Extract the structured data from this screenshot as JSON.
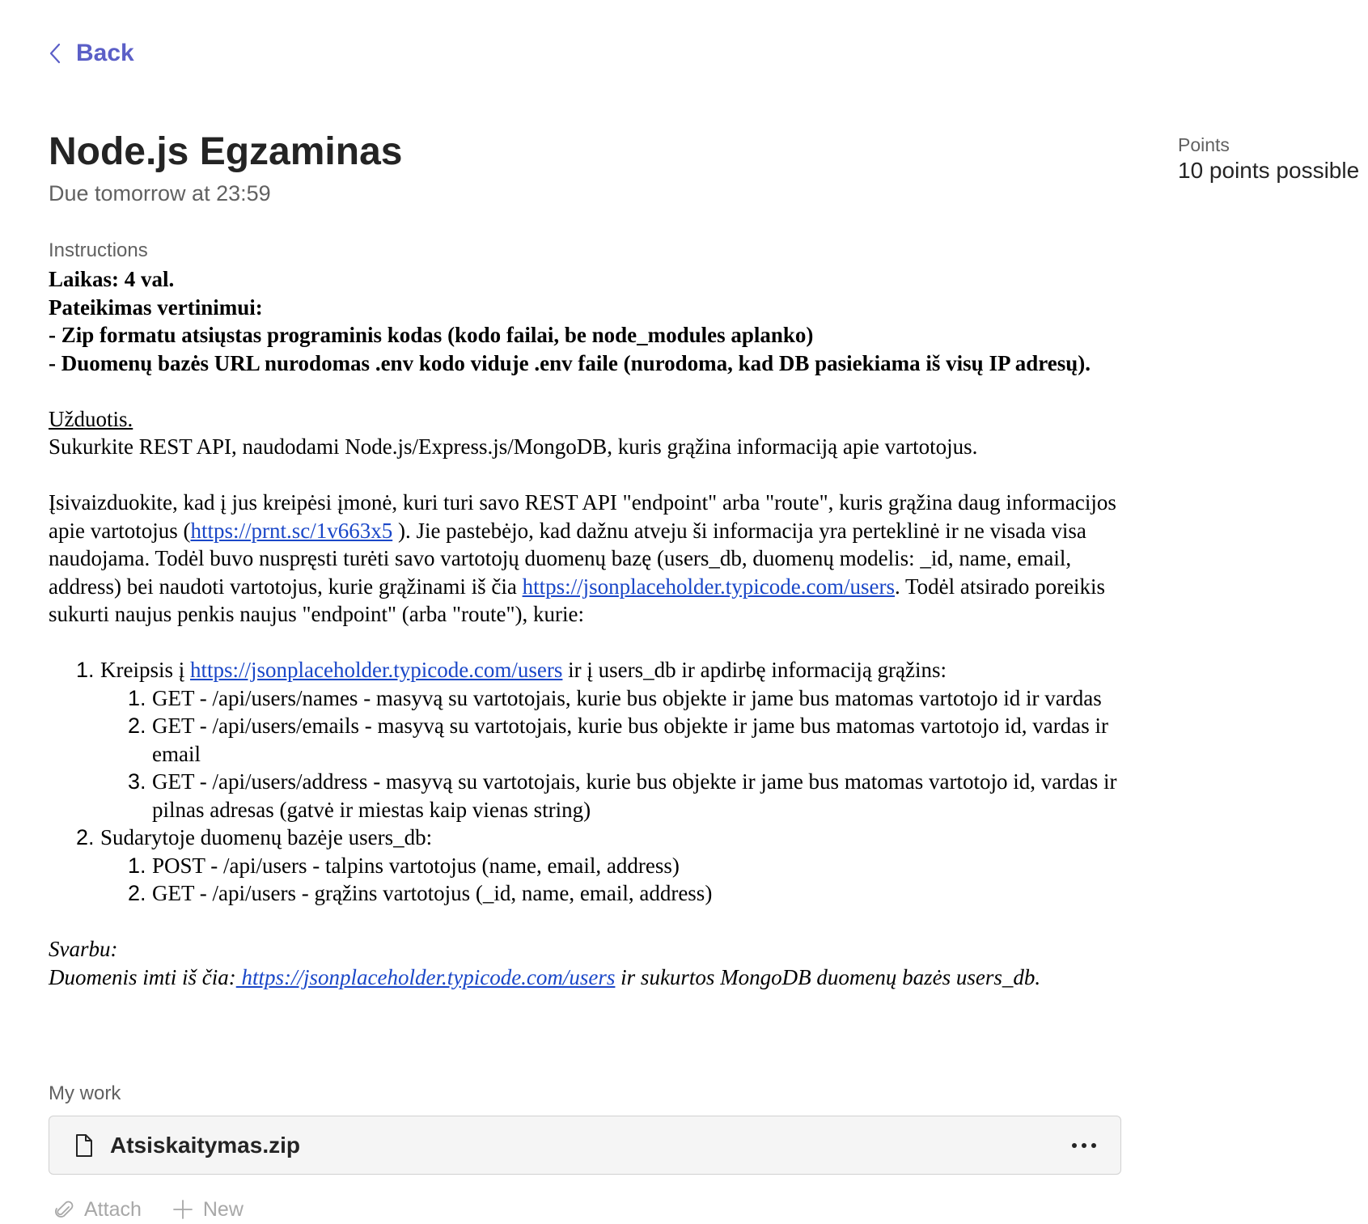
{
  "nav": {
    "back_label": "Back",
    "back_icon": "chevron-left-icon"
  },
  "colors": {
    "accent": "#5b5fc7",
    "link": "#1a47c8",
    "muted": "#616161",
    "disabled": "#a8a8a8"
  },
  "assignment": {
    "title": "Node.js Egzaminas",
    "due": "Due tomorrow at 23:59",
    "points_label": "Points",
    "points_value": "10 points possible"
  },
  "instructions": {
    "label": "Instructions",
    "header": [
      "Laikas: 4 val.",
      "Pateikimas vertinimui:",
      "- Zip formatu atsiųstas programinis kodas (kodo failai, be node_modules aplanko)",
      "- Duomenų bazės URL nurodomas .env kodo viduje .env faile (nurodoma, kad DB pasiekiama iš visų IP adresų)."
    ],
    "task_heading": "Užduotis. ",
    "task_text": "Sukurkite REST API, naudodami Node.js/Express.js/MongoDB, kuris grąžina informaciją apie vartotojus.",
    "para": {
      "t1": "Įsivaizduokite, kad į jus kreipėsi įmonė, kuri turi savo REST API \"endpoint\" arba \"route\", kuris grąžina daug informacijos apie vartotojus (",
      "link1": "https://prnt.sc/1v663x5",
      "t2": " ). Jie pastebėjo, kad dažnu atveju ši informacija yra perteklinė ir ne visada visa naudojama. Todėl buvo nuspręsti turėti savo vartotojų duomenų bazę (users_db, duomenų modelis: _id, name, email, address) bei naudoti vartotojus, kurie grąžinami iš čia ",
      "link2": "https://jsonplaceholder.typicode.com/users",
      "t3": ". Todėl atsirado poreikis sukurti naujus penkis naujus \"endpoint\" (arba \"route\"), kurie:"
    },
    "list1": {
      "pre": "Kreipsis į ",
      "link": "https://jsonplaceholder.typicode.com/users",
      "post": " ir į users_db ir apdirbę informaciją grąžins:",
      "items": [
        "GET - /api/users/names - masyvą su vartotojais, kurie bus objekte ir jame bus matomas vartotojo id ir vardas",
        "GET - /api/users/emails - masyvą su vartotojais, kurie bus objekte ir jame bus matomas vartotojo id, vardas ir email",
        "GET - /api/users/address - masyvą su vartotojais, kurie bus objekte ir jame bus matomas vartotojo id, vardas ir pilnas adresas (gatvė ir miestas kaip vienas string)"
      ]
    },
    "list2": {
      "text": "Sudarytoje duomenų bazėje users_db:",
      "items": [
        "POST - /api/users - talpins vartotojus (name, email, address)",
        "GET - /api/users - grąžins vartotojus (_id, name, email, address)"
      ]
    },
    "important": {
      "label": "Svarbu:",
      "pre": "Duomenis imti iš čia:",
      "link": " https://jsonplaceholder.typicode.com/users",
      "post": " ir  sukurtos MongoDB duomenų bazės users_db."
    }
  },
  "my_work": {
    "label": "My work",
    "file_name": "Atsiskaitymas.zip",
    "file_icon": "document-icon",
    "more_icon": "more-horizontal-icon",
    "attach_label": "Attach",
    "new_label": "New"
  }
}
